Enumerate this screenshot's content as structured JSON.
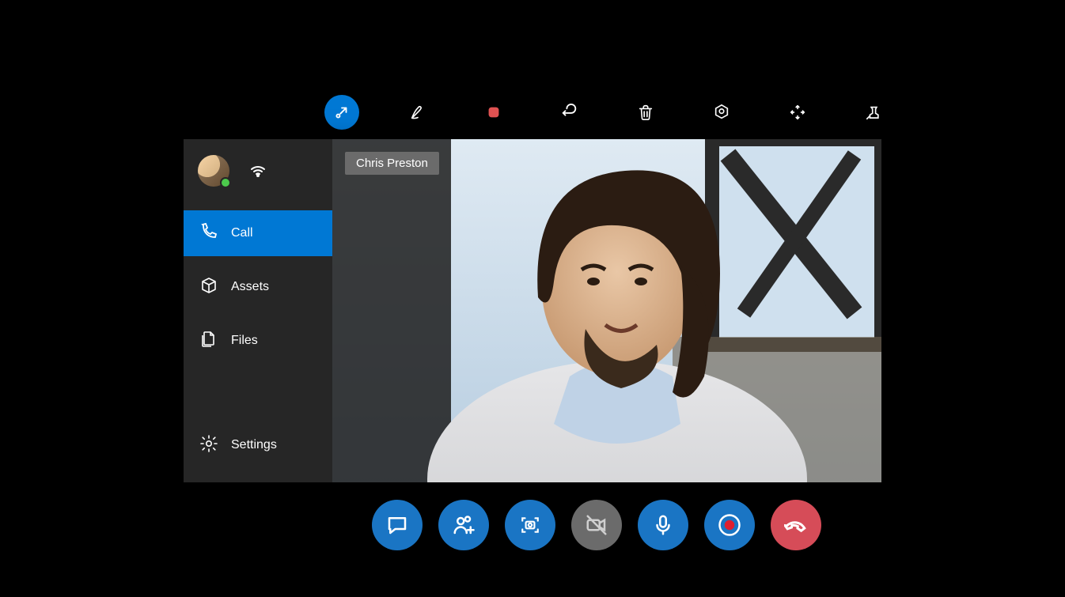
{
  "toolbar": {
    "items": [
      {
        "name": "minimize-collapse",
        "active": true
      },
      {
        "name": "ink-pen"
      },
      {
        "name": "stop-record",
        "red": true
      },
      {
        "name": "undo"
      },
      {
        "name": "delete"
      },
      {
        "name": "marker-place"
      },
      {
        "name": "expand-move"
      },
      {
        "name": "pin"
      }
    ]
  },
  "sidebar": {
    "presence": "available",
    "items": [
      {
        "key": "call",
        "label": "Call",
        "icon": "phone-icon",
        "selected": true
      },
      {
        "key": "assets",
        "label": "Assets",
        "icon": "box-icon",
        "selected": false
      },
      {
        "key": "files",
        "label": "Files",
        "icon": "files-icon",
        "selected": false
      },
      {
        "key": "settings",
        "label": "Settings",
        "icon": "gear-icon",
        "selected": false
      }
    ]
  },
  "video": {
    "participant_name": "Chris Preston"
  },
  "call_controls": [
    {
      "name": "chat",
      "icon": "chat-icon",
      "color": "blue"
    },
    {
      "name": "add-people",
      "icon": "add-person-icon",
      "color": "blue"
    },
    {
      "name": "screenshot",
      "icon": "camera-frame-icon",
      "color": "blue"
    },
    {
      "name": "video-off",
      "icon": "video-off-icon",
      "color": "grey"
    },
    {
      "name": "microphone",
      "icon": "mic-icon",
      "color": "blue"
    },
    {
      "name": "record",
      "icon": "record-icon",
      "color": "blue"
    },
    {
      "name": "hang-up",
      "icon": "hangup-icon",
      "color": "red"
    }
  ],
  "colors": {
    "accent": "#0078d4",
    "danger": "#d64c58",
    "grey": "#6b6b6b",
    "record_red": "#e15353"
  }
}
